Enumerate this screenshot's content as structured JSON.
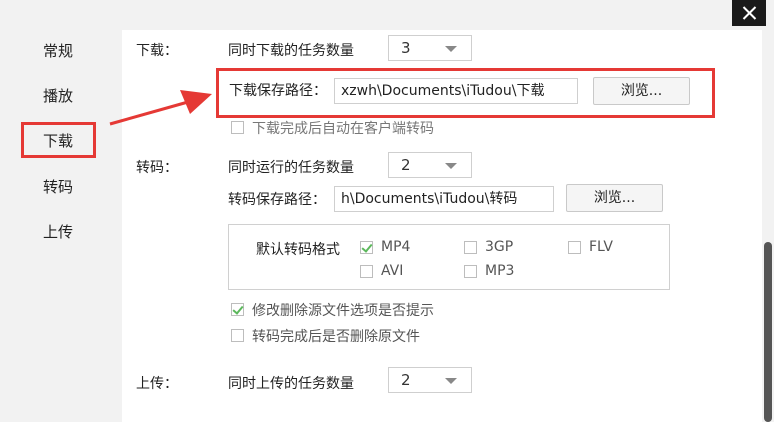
{
  "window": {
    "close_label": "×"
  },
  "sidebar": {
    "items": [
      {
        "label": "常规"
      },
      {
        "label": "播放"
      },
      {
        "label": "下载"
      },
      {
        "label": "转码"
      },
      {
        "label": "上传"
      }
    ],
    "selected": "下载"
  },
  "download": {
    "section_label": "下载：",
    "concurrent_label": "同时下载的任务数量",
    "concurrent_value": "3",
    "path_label": "下载保存路径：",
    "path_value": "xzwh\\Documents\\iTudou\\下载",
    "browse_label": "浏览...",
    "auto_transcode_label": "下载完成后自动在客户端转码",
    "auto_transcode_checked": false
  },
  "transcode": {
    "section_label": "转码：",
    "concurrent_label": "同时运行的任务数量",
    "concurrent_value": "2",
    "path_label": "转码保存路径：",
    "path_value": "h\\Documents\\iTudou\\转码",
    "browse_label": "浏览...",
    "default_format_label": "默认转码格式",
    "formats": [
      {
        "label": "MP4",
        "checked": true
      },
      {
        "label": "3GP",
        "checked": false
      },
      {
        "label": "FLV",
        "checked": false
      },
      {
        "label": "AVI",
        "checked": false
      },
      {
        "label": "MP3",
        "checked": false
      }
    ],
    "prompt_delete_label": "修改删除源文件选项是否提示",
    "prompt_delete_checked": true,
    "delete_source_label": "转码完成后是否删除原文件",
    "delete_source_checked": false
  },
  "upload": {
    "section_label": "上传：",
    "concurrent_label": "同时上传的任务数量",
    "concurrent_value": "2"
  },
  "colors": {
    "annotation_red": "#e53935",
    "check_green": "#5cb85c"
  }
}
